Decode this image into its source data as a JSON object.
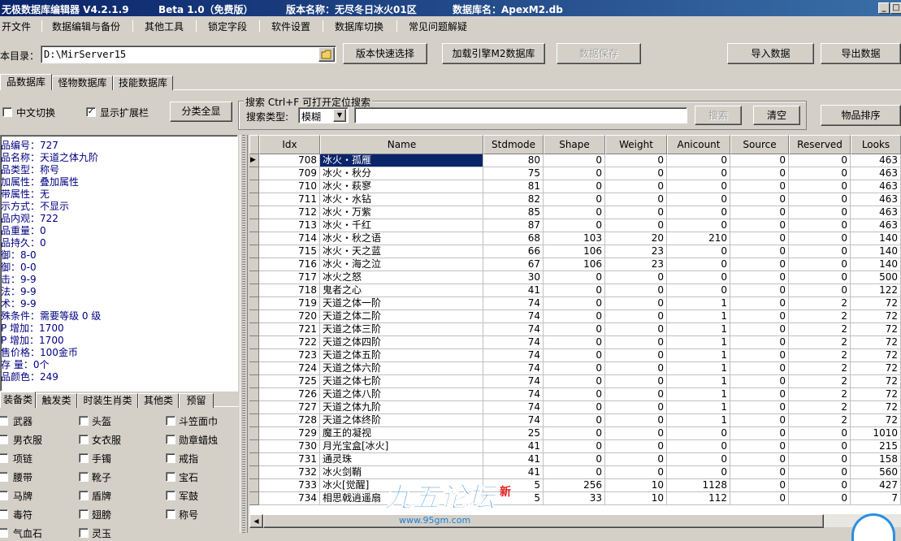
{
  "window": {
    "app_title": "无极数据库编辑器 V4.2.1.9",
    "edition": "Beta 1.0（免费版）",
    "version_label": "版本名称：无尽冬日冰火01区",
    "db_label": "数据库名：ApexM2.db"
  },
  "menu": [
    "开文件",
    "数据编辑与备份",
    "其他工具",
    "锁定字段",
    "软件设置",
    "数据库切换",
    "常见问题解疑"
  ],
  "toolbar": {
    "dir_label": "本目录：",
    "dir_value": "D:\\MirServer15",
    "quick_select": "版本快速选择",
    "load_engine": "加载引擎M2数据库",
    "save_data": "数据保存",
    "import_data": "导入数据",
    "export_data": "导出数据"
  },
  "main_tabs": [
    "品数据库",
    "怪物数据库",
    "技能数据库"
  ],
  "options": {
    "chinese_switch": "中文切换",
    "show_ext_bar": "显示扩展栏",
    "show_all_classes": "分类全显"
  },
  "search": {
    "group_label": "搜索   Ctrl+F 可打开定位搜索",
    "type_label": "搜索类型:",
    "type_value": "模糊",
    "input_value": "",
    "search_button": "搜索",
    "clear_button": "清空",
    "sort_button": "物品排序"
  },
  "item_info": [
    "品编号：727",
    "品名称：天道之体九阶",
    "品类型：称号",
    "加属性：叠加属性",
    "带属性：无",
    "示方式：不显示",
    "品内观：722",
    "品重量：0",
    "品持久：0",
    "     御：8-0",
    "     御：0-0",
    "     击：9-9",
    "     法：9-9",
    "     术：9-9",
    "殊条件：需要等级 0 级",
    "P   增加：1700",
    "P   增加：1700",
    "售价格：100金币",
    " 存 量：0个",
    "品颜色：249"
  ],
  "category_tabs": [
    "装备类",
    "触发类",
    "时装生肖类",
    "其他类",
    "预留"
  ],
  "categories": [
    "武器",
    "头盔",
    "斗笠面巾",
    "男衣服",
    "女衣服",
    "勋章蜡烛",
    "项链",
    "手镯",
    "戒指",
    "腰带",
    "靴子",
    "宝石",
    "马牌",
    "盾牌",
    "军鼓",
    "毒符",
    "翅膀",
    "称号",
    "气血石",
    "灵玉"
  ],
  "grid": {
    "columns": [
      "Idx",
      "Name",
      "Stdmode",
      "Shape",
      "Weight",
      "Anicount",
      "Source",
      "Reserved",
      "Looks"
    ],
    "selected_row": 0,
    "rows": [
      [
        "708",
        "冰火・孤雁",
        "80",
        "0",
        "0",
        "0",
        "0",
        "0",
        "463"
      ],
      [
        "709",
        "冰火・秋分",
        "75",
        "0",
        "0",
        "0",
        "0",
        "0",
        "463"
      ],
      [
        "710",
        "冰火・萩寥",
        "81",
        "0",
        "0",
        "0",
        "0",
        "0",
        "463"
      ],
      [
        "711",
        "冰火・水钻",
        "82",
        "0",
        "0",
        "0",
        "0",
        "0",
        "463"
      ],
      [
        "712",
        "冰火・万紫",
        "85",
        "0",
        "0",
        "0",
        "0",
        "0",
        "463"
      ],
      [
        "713",
        "冰火・千红",
        "87",
        "0",
        "0",
        "0",
        "0",
        "0",
        "463"
      ],
      [
        "714",
        "冰火・秋之语",
        "68",
        "103",
        "20",
        "210",
        "0",
        "0",
        "140"
      ],
      [
        "715",
        "冰火・天之蓝",
        "66",
        "106",
        "23",
        "0",
        "0",
        "0",
        "140"
      ],
      [
        "716",
        "冰火・海之泣",
        "67",
        "106",
        "23",
        "0",
        "0",
        "0",
        "140"
      ],
      [
        "717",
        "冰火之怒",
        "30",
        "0",
        "0",
        "0",
        "0",
        "0",
        "500"
      ],
      [
        "718",
        "鬼者之心",
        "41",
        "0",
        "0",
        "0",
        "0",
        "0",
        "122"
      ],
      [
        "719",
        "天道之体一阶",
        "74",
        "0",
        "0",
        "1",
        "0",
        "2",
        "72"
      ],
      [
        "720",
        "天道之体二阶",
        "74",
        "0",
        "0",
        "1",
        "0",
        "2",
        "72"
      ],
      [
        "721",
        "天道之体三阶",
        "74",
        "0",
        "0",
        "1",
        "0",
        "2",
        "72"
      ],
      [
        "722",
        "天道之体四阶",
        "74",
        "0",
        "0",
        "1",
        "0",
        "2",
        "72"
      ],
      [
        "723",
        "天道之体五阶",
        "74",
        "0",
        "0",
        "1",
        "0",
        "2",
        "72"
      ],
      [
        "724",
        "天道之体六阶",
        "74",
        "0",
        "0",
        "1",
        "0",
        "2",
        "72"
      ],
      [
        "725",
        "天道之体七阶",
        "74",
        "0",
        "0",
        "1",
        "0",
        "2",
        "72"
      ],
      [
        "726",
        "天道之体八阶",
        "74",
        "0",
        "0",
        "1",
        "0",
        "2",
        "72"
      ],
      [
        "727",
        "天道之体九阶",
        "74",
        "0",
        "0",
        "1",
        "0",
        "2",
        "72"
      ],
      [
        "728",
        "天道之体终阶",
        "74",
        "0",
        "0",
        "1",
        "0",
        "2",
        "72"
      ],
      [
        "729",
        "魔王的凝视",
        "25",
        "0",
        "0",
        "0",
        "0",
        "0",
        "1010"
      ],
      [
        "730",
        "月光宝盒[冰火]",
        "41",
        "0",
        "0",
        "0",
        "0",
        "0",
        "215"
      ],
      [
        "731",
        "通灵珠",
        "41",
        "0",
        "0",
        "0",
        "0",
        "0",
        "158"
      ],
      [
        "732",
        "冰火剑鞘",
        "41",
        "0",
        "0",
        "0",
        "0",
        "0",
        "560"
      ],
      [
        "733",
        "冰火[觉醒]",
        "5",
        "256",
        "10",
        "1128",
        "0",
        "0",
        "427"
      ],
      [
        "734",
        "相思戟逍遥扇",
        "5",
        "33",
        "10",
        "112",
        "0",
        "0",
        "7"
      ]
    ]
  },
  "watermark": {
    "text": "九五论坛",
    "url": "www.95gm.com",
    "badge": "新"
  },
  "colors": {
    "title_bar": "#0a246a",
    "info_text": "#000080",
    "selection": "#0a246a",
    "watermark": "#1a7fd6"
  }
}
